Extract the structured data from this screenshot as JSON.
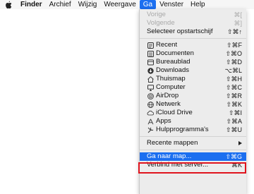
{
  "menubar": {
    "apple_icon": "apple-logo-icon",
    "items": [
      "Finder",
      "Archief",
      "Wijzig",
      "Weergave",
      "Ga",
      "Venster",
      "Help"
    ]
  },
  "menu": {
    "top": [
      {
        "label": "Vorige",
        "shortcut": "⌘[",
        "disabled": true
      },
      {
        "label": "Volgende",
        "shortcut": "⌘]",
        "disabled": true
      },
      {
        "label": "Selecteer opstartschijf",
        "shortcut": "⇧⌘↑"
      }
    ],
    "places": [
      {
        "label": "Recent",
        "shortcut": "⇧⌘F",
        "icon": "recent-icon"
      },
      {
        "label": "Documenten",
        "shortcut": "⇧⌘O",
        "icon": "documents-icon"
      },
      {
        "label": "Bureaublad",
        "shortcut": "⇧⌘D",
        "icon": "desktop-icon"
      },
      {
        "label": "Downloads",
        "shortcut": "⌥⌘L",
        "icon": "downloads-icon"
      },
      {
        "label": "Thuismap",
        "shortcut": "⇧⌘H",
        "icon": "home-icon"
      },
      {
        "label": "Computer",
        "shortcut": "⇧⌘C",
        "icon": "computer-icon"
      },
      {
        "label": "AirDrop",
        "shortcut": "⇧⌘R",
        "icon": "airdrop-icon"
      },
      {
        "label": "Netwerk",
        "shortcut": "⇧⌘K",
        "icon": "network-icon"
      },
      {
        "label": "iCloud Drive",
        "shortcut": "⇧⌘I",
        "icon": "icloud-icon"
      },
      {
        "label": "Apps",
        "shortcut": "⇧⌘A",
        "icon": "apps-icon"
      },
      {
        "label": "Hulpprogramma's",
        "shortcut": "⇧⌘U",
        "icon": "utilities-icon"
      }
    ],
    "recent_folders": {
      "label": "Recente mappen"
    },
    "go_to_folder": {
      "label": "Ga naar map...",
      "shortcut": "⇧⌘G"
    },
    "connect_server": {
      "label": "Verbind met server...",
      "shortcut": "⌘K"
    }
  },
  "colors": {
    "accent": "#1c6ff0",
    "highlight_border": "#e0141e"
  }
}
